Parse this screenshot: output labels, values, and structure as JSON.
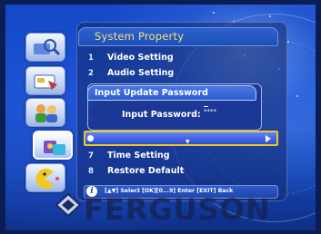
{
  "window": {
    "title": "System Property"
  },
  "menu": {
    "items": [
      {
        "num": "1",
        "label": "Video Setting"
      },
      {
        "num": "2",
        "label": "Audio Setting"
      },
      {
        "num": "3",
        "label": ""
      },
      {
        "num": "4",
        "label": ""
      },
      {
        "num": "5",
        "label": ""
      },
      {
        "num": "",
        "label": ""
      },
      {
        "num": "7",
        "label": "Time Setting"
      },
      {
        "num": "8",
        "label": "Restore Default"
      }
    ],
    "selected_index": 5
  },
  "dialog": {
    "title": "Input Update Password",
    "label": "Input Password:",
    "value": "****"
  },
  "help": {
    "icon_glyph": "i",
    "text": "[▲▼] Select [OK][0...9] Enter [EXIT] Back"
  },
  "brand": {
    "logo_text": "FERGUSON"
  },
  "icons": {
    "sidebar": [
      "satellite-search-icon",
      "card-key-icon",
      "users-icon",
      "game-icon",
      "pacman-icon"
    ]
  },
  "colors": {
    "title_text": "#f7e07a",
    "selection_border": "#f0c81e",
    "background": "#1548c6"
  }
}
